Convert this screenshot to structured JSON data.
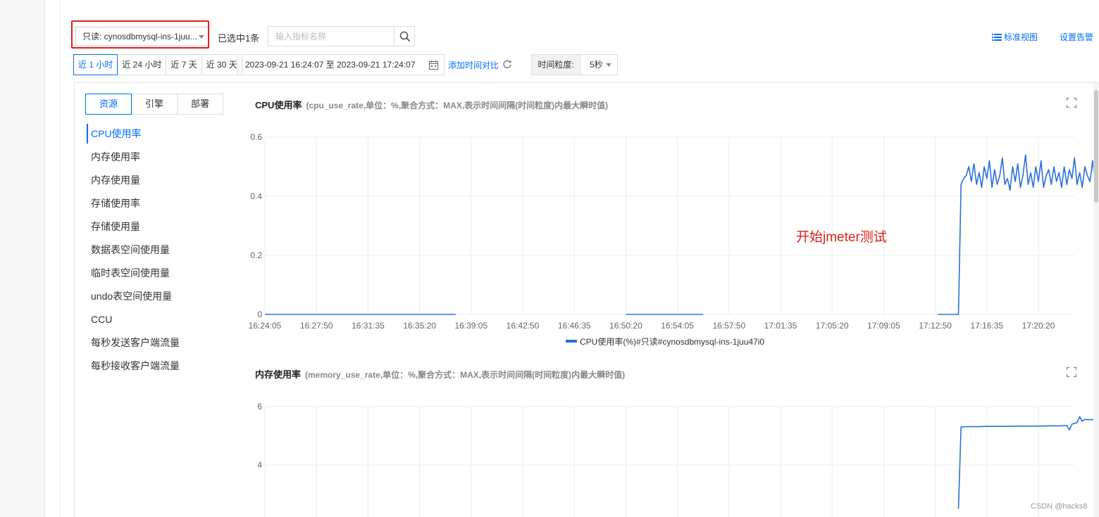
{
  "toolbar": {
    "instance_select": "只读: cynosdbmysql-ins-1juu...",
    "selected_count": "已选中1条",
    "search_placeholder": "输入指标名称",
    "std_view": "标准视图",
    "set_alarm": "设置告警"
  },
  "time": {
    "tabs": [
      "近 1 小时",
      "近 24 小时",
      "近 7 天",
      "近 30 天"
    ],
    "active_tab": "近 1 小时",
    "range": "2023-09-21 16:24:07 至 2023-09-21 17:24:07",
    "add_compare": "添加时间对比",
    "granularity_label": "时间粒度:",
    "granularity_value": "5秒"
  },
  "metric_tabs": [
    "资源",
    "引擎",
    "部署"
  ],
  "metrics": [
    "CPU使用率",
    "内存使用率",
    "内存使用量",
    "存储使用率",
    "存储使用量",
    "数据表空间使用量",
    "临时表空间使用量",
    "undo表空间使用量",
    "CCU",
    "每秒发送客户端流量",
    "每秒接收客户端流量"
  ],
  "annotation": "开始jmeter测试",
  "watermark": "CSDN @hacks8",
  "colors": {
    "accent": "#006eff",
    "series": "#2a6fdb",
    "highlight": "#e0201c"
  },
  "chart_data": [
    {
      "type": "line",
      "title": "CPU使用率",
      "subtitle": "(cpu_use_rate,单位：%,聚合方式：MAX,表示时间间隔(时间粒度)内最大瞬时值)",
      "categories": [
        "16:24:05",
        "16:27:50",
        "16:31:35",
        "16:35:20",
        "16:39:05",
        "16:42:50",
        "16:46:35",
        "16:50:20",
        "16:54:05",
        "16:57:50",
        "17:01:35",
        "17:05:20",
        "17:09:05",
        "17:12:50",
        "17:16:35",
        "17:20:20"
      ],
      "ylim": [
        0,
        0.6
      ],
      "yticks": [
        0,
        0.2,
        0.4,
        0.6
      ],
      "ytick_labels": [
        "0",
        "0.2",
        "0.4",
        "0.6"
      ],
      "grid": true,
      "legend": "bottom",
      "series": [
        {
          "name": "CPU使用率(%)#只读#cynosdbmysql-ins-1juu47i0",
          "x": [
            0,
            3.7,
            3.75,
            7.0,
            7.05,
            8.5,
            8.55,
            13.05,
            13.1,
            13.45,
            13.5,
            13.55,
            13.6,
            13.65,
            13.7,
            13.75,
            13.8,
            13.85,
            13.9,
            13.95,
            14.0,
            14.05,
            14.1,
            14.15,
            14.2,
            14.25,
            14.3,
            14.35,
            14.4,
            14.45,
            14.5,
            14.55,
            14.6,
            14.65,
            14.7,
            14.75,
            14.8,
            14.85,
            14.9,
            14.95,
            15.0,
            15.05,
            15.1,
            15.15,
            15.2,
            15.25,
            15.3,
            15.35,
            15.4,
            15.45,
            15.5,
            15.55,
            15.6,
            15.65,
            15.7,
            15.75,
            15.8,
            15.85,
            15.9,
            15.95,
            16.0,
            16.05,
            16.1,
            16.15,
            16.2,
            16.25,
            16.3,
            16.35,
            16.4,
            16.45,
            16.5,
            16.55,
            16.6,
            16.65,
            16.7,
            16.75,
            16.8
          ],
          "values": [
            0,
            0,
            null,
            0,
            0,
            0,
            null,
            0,
            0,
            0,
            0.44,
            0.46,
            0.47,
            0.5,
            0.45,
            0.51,
            0.44,
            0.48,
            0.43,
            0.5,
            0.46,
            0.52,
            0.43,
            0.49,
            0.44,
            0.47,
            0.53,
            0.44,
            0.46,
            0.42,
            0.5,
            0.45,
            0.51,
            0.43,
            0.47,
            0.54,
            0.44,
            0.48,
            0.43,
            0.5,
            0.45,
            0.52,
            0.43,
            0.47,
            0.49,
            0.44,
            0.5,
            0.45,
            0.48,
            0.43,
            0.5,
            0.44,
            0.49,
            0.46,
            0.53,
            0.44,
            0.48,
            0.43,
            0.5,
            0.47,
            0.45,
            0.52,
            0.44,
            0.49,
            0.45,
            0.51,
            0.46,
            0.5,
            0.44,
            0.48,
            0.5,
            0.43,
            0.47,
            0.55,
            0.45,
            0.42,
            0.43
          ]
        }
      ]
    },
    {
      "type": "line",
      "title": "内存使用率",
      "subtitle": "(memory_use_rate,单位：%,聚合方式：MAX,表示时间间隔(时间粒度)内最大瞬时值)",
      "yticks": [
        4,
        6
      ],
      "ytick_labels": [
        "4",
        "6"
      ],
      "grid": true,
      "series": [
        {
          "x": [
            13.45,
            13.5,
            13.6,
            13.8,
            14.0,
            14.2,
            14.4,
            14.6,
            14.8,
            15.0,
            15.2,
            15.4,
            15.55,
            15.6,
            15.65,
            15.75,
            15.8,
            15.85,
            15.9,
            16.0,
            16.2,
            16.4,
            16.6,
            16.7,
            16.75
          ],
          "values": [
            2.5,
            5.3,
            5.31,
            5.31,
            5.32,
            5.32,
            5.32,
            5.33,
            5.33,
            5.33,
            5.34,
            5.34,
            5.35,
            5.2,
            5.4,
            5.45,
            5.65,
            5.5,
            5.56,
            5.55,
            5.56,
            5.55,
            5.56,
            5.55,
            5.53
          ]
        }
      ]
    }
  ]
}
